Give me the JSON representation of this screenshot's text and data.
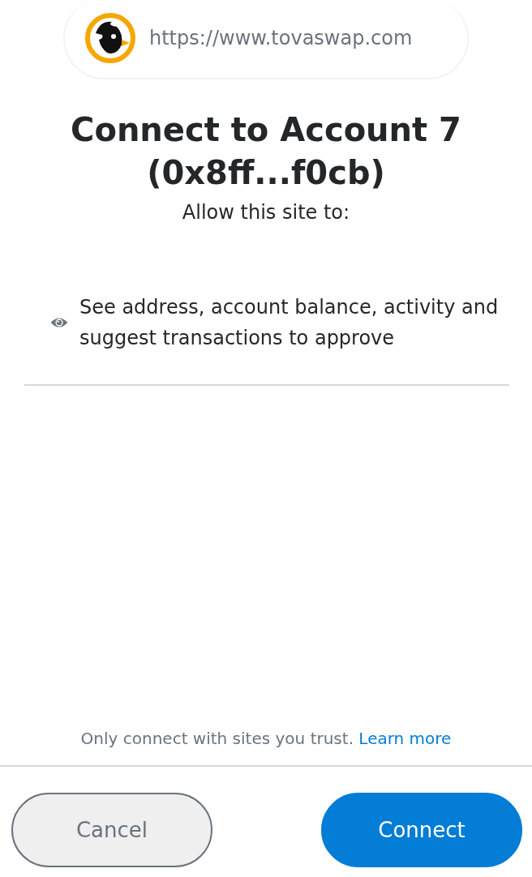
{
  "site": {
    "url": "https://www.tovaswap.com"
  },
  "title": [
    "Connect to Account 7",
    "(0x8ff...f0cb)"
  ],
  "subtitle": "Allow this site to:",
  "permissions": [
    {
      "kind": "view",
      "text": "See address, account balance, activity and suggest transactions to approve"
    }
  ],
  "footer": {
    "note": "Only connect with sites you trust.",
    "link": "Learn more"
  },
  "buttons": [
    {
      "label": "Cancel",
      "kind": "secondary"
    },
    {
      "label": "Connect",
      "kind": "primary"
    }
  ]
}
